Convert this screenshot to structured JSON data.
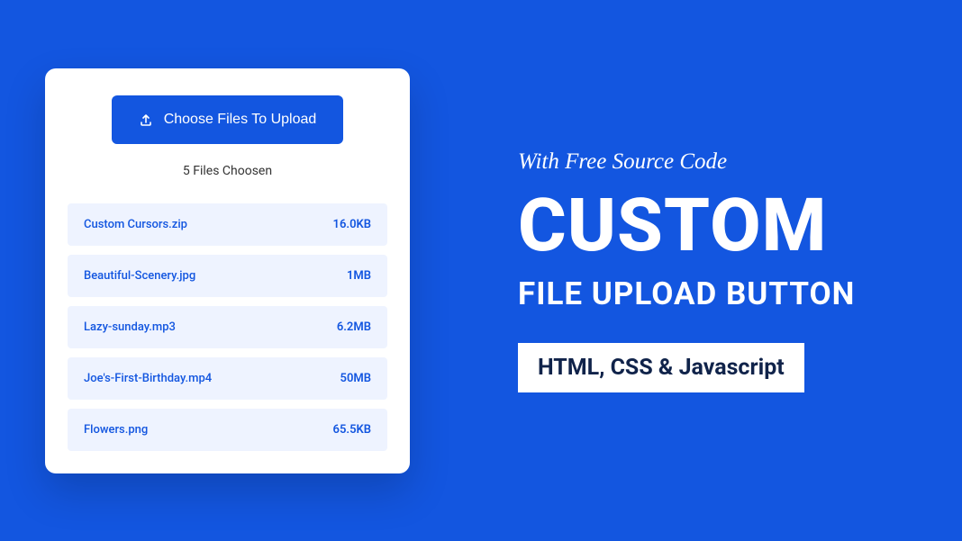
{
  "upload": {
    "button_label": "Choose Files To Upload",
    "count_text": "5 Files Choosen",
    "files": [
      {
        "name": "Custom Cursors.zip",
        "size": "16.0KB"
      },
      {
        "name": "Beautiful-Scenery.jpg",
        "size": "1MB"
      },
      {
        "name": "Lazy-sunday.mp3",
        "size": "6.2MB"
      },
      {
        "name": "Joe's-First-Birthday.mp4",
        "size": "50MB"
      },
      {
        "name": "Flowers.png",
        "size": "65.5KB"
      }
    ]
  },
  "promo": {
    "tagline": "With Free Source Code",
    "title": "CUSTOM",
    "subtitle": "FILE UPLOAD BUTTON",
    "tech_badge": "HTML, CSS & Javascript"
  }
}
